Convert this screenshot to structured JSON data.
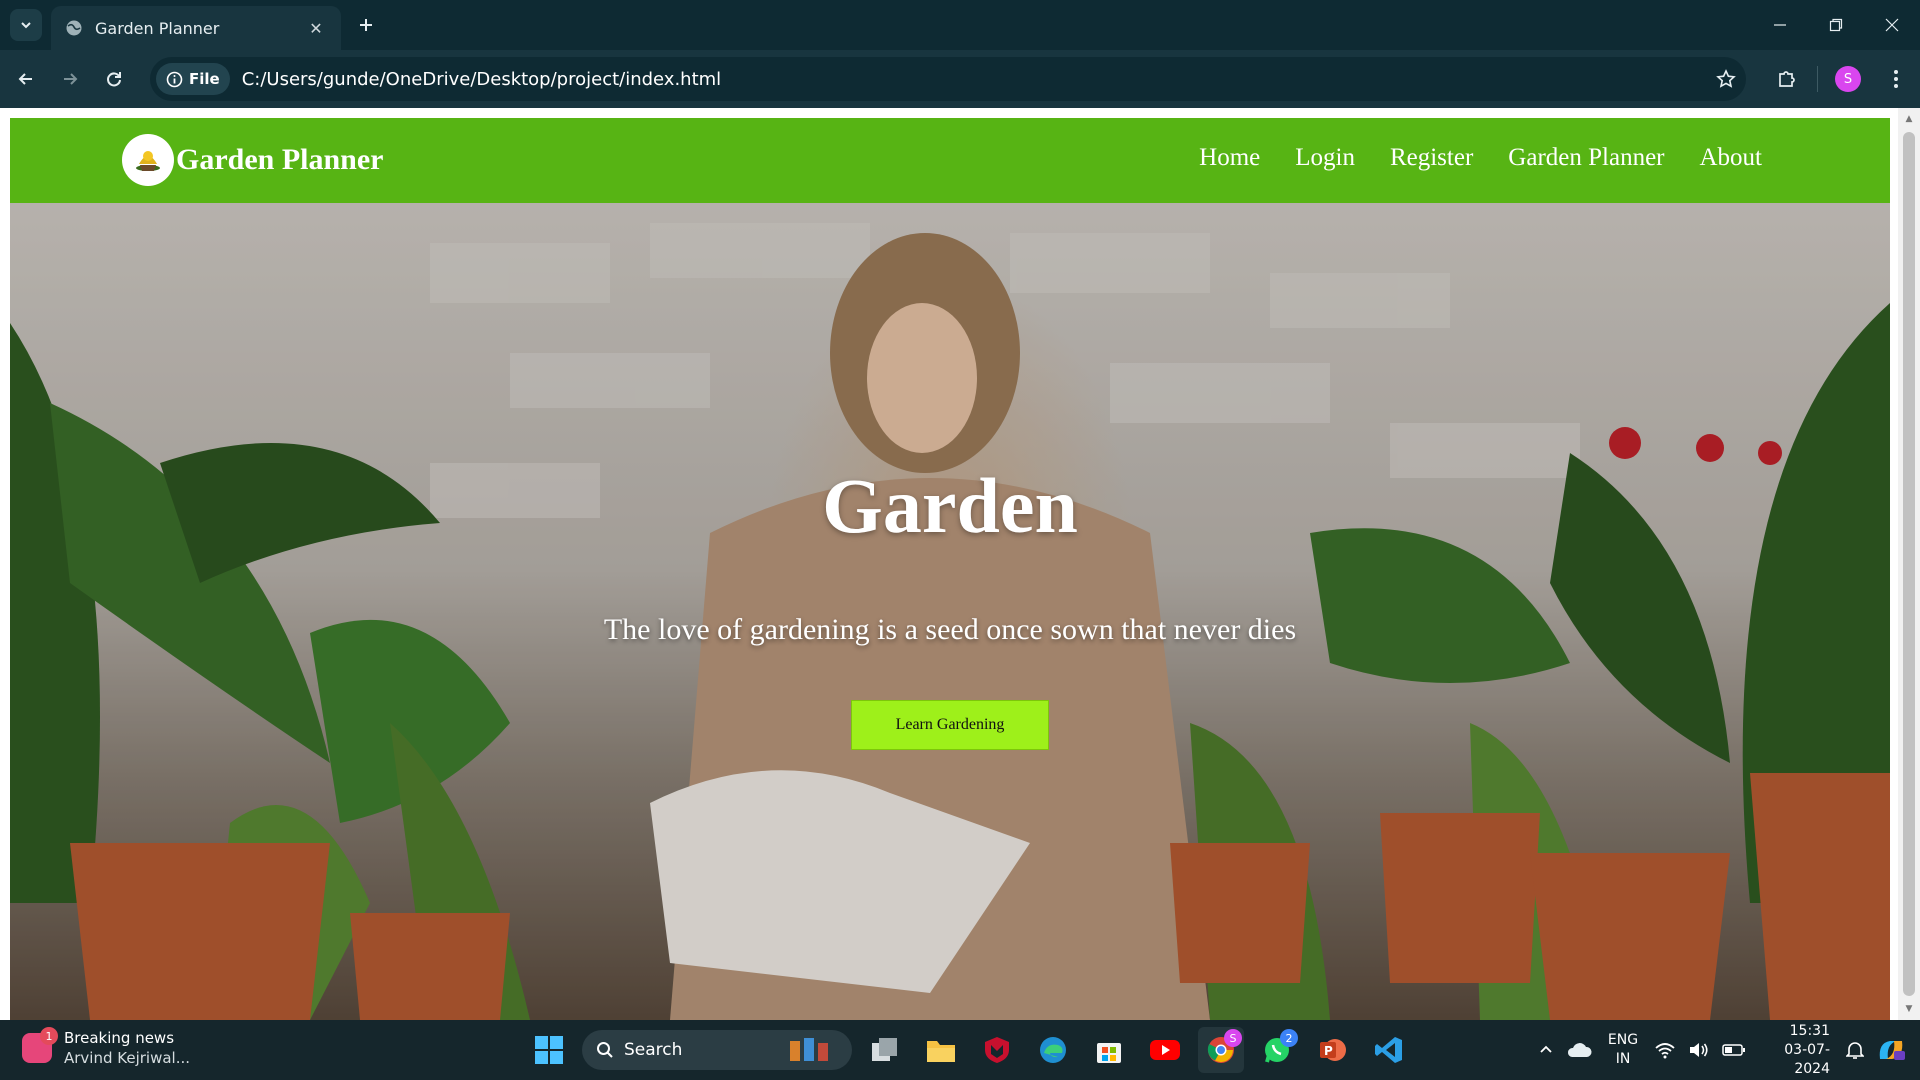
{
  "browser": {
    "tab_title": "Garden Planner",
    "address_chip": "File",
    "url": "C:/Users/gunde/OneDrive/Desktop/project/index.html",
    "profile_initial": "S"
  },
  "site": {
    "brand": "Garden Planner",
    "nav": [
      "Home",
      "Login",
      "Register",
      "Garden Planner",
      "About"
    ],
    "hero": {
      "title": "Garden",
      "subtitle": "The love of gardening is a seed once sown that never dies",
      "button": "Learn Gardening"
    },
    "colors": {
      "navbar": "#57b414",
      "button": "#9ef01a"
    }
  },
  "taskbar": {
    "news_title": "Breaking news",
    "news_sub": "Arvind Kejriwal...",
    "news_badge": "1",
    "search_label": "Search",
    "chrome_badge": "S",
    "whatsapp_badge": "2",
    "lang_line1": "ENG",
    "lang_line2": "IN",
    "time": "15:31",
    "date": "03-07-2024"
  }
}
